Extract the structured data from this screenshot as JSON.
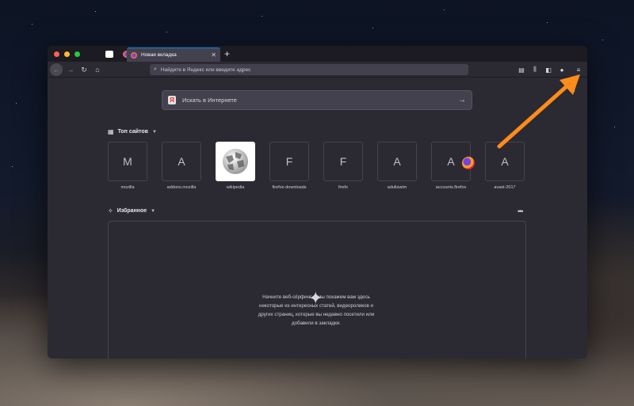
{
  "browser": {
    "active_tab_title": "Новая вкладка",
    "urlbar_placeholder": "Найдите в Яндекс или введите адрес"
  },
  "newtab": {
    "search_placeholder": "Искать в Интернете",
    "search_engine_logo": "Я",
    "top_sites_heading": "Топ сайтов",
    "highlights_heading": "Избранное",
    "top_sites": [
      {
        "letter": "M",
        "label": "mozilla"
      },
      {
        "letter": "A",
        "label": "addons.mozilla"
      },
      {
        "letter": "",
        "label": "wikipedia"
      },
      {
        "letter": "F",
        "label": "firefox-downloads"
      },
      {
        "letter": "F",
        "label": "firefx"
      },
      {
        "letter": "A",
        "label": "adultswim"
      },
      {
        "letter": "A",
        "label": "accounts.firefox"
      },
      {
        "letter": "A",
        "label": "avast-2017"
      }
    ],
    "highlights_empty_lines": [
      "Начните веб-сёрфинг, и мы покажем вам здесь",
      "некоторые из интересных статей, видеороликов и",
      "других страниц, которые вы недавно посетили или",
      "добавили в закладки."
    ]
  },
  "colors": {
    "accent": "#0a84ff",
    "annotation_arrow": "#ff8c1a",
    "window_bg": "#2b2a33"
  },
  "icons": [
    "back-icon",
    "forward-icon",
    "reload-icon",
    "home-icon",
    "search-icon",
    "library-icon",
    "sidebar-icon",
    "account-icon",
    "hamburger-menu-icon",
    "gear-icon",
    "arrow-right-icon",
    "sparkle-icon",
    "more-dots-icon"
  ]
}
